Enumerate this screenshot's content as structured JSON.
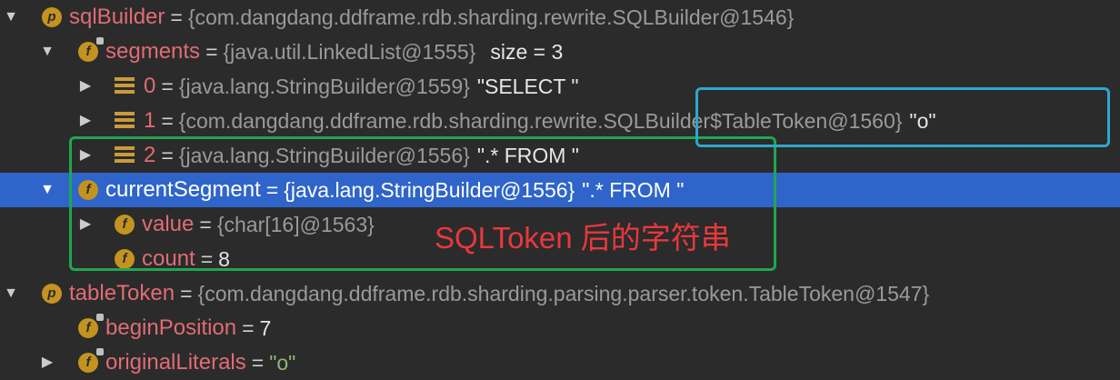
{
  "variables": [
    {
      "arrow": "▼",
      "icon": "p",
      "name": "sqlBuilder",
      "ref": "{com.dangdang.ddframe.rdb.sharding.rewrite.SQLBuilder@1546}"
    },
    {
      "arrow": "▼",
      "icon": "f",
      "name": "segments",
      "ref": "{java.util.LinkedList@1555}",
      "size": "size = 3"
    },
    {
      "arrow": "▶",
      "index": "0",
      "ref": "{java.lang.StringBuilder@1559}",
      "value": "\"SELECT \""
    },
    {
      "arrow": "▶",
      "index": "1",
      "ref": "{com.dangdang.ddframe.rdb.sharding.rewrite.SQLBuilder$TableToken@1560}",
      "value": "\"o\""
    },
    {
      "arrow": "▶",
      "index": "2",
      "ref": "{java.lang.StringBuilder@1556}",
      "value": "\".* FROM \""
    },
    {
      "arrow": "▼",
      "icon": "f",
      "name": "currentSegment",
      "ref": "{java.lang.StringBuilder@1556}",
      "value": "\".* FROM \""
    },
    {
      "arrow": "▶",
      "icon": "f",
      "name": "value",
      "ref": "{char[16]@1563}"
    },
    {
      "icon": "f",
      "name": "count",
      "value": "8"
    },
    {
      "arrow": "▼",
      "icon": "p",
      "name": "tableToken",
      "ref": "{com.dangdang.ddframe.rdb.sharding.parsing.parser.token.TableToken@1547}"
    },
    {
      "icon": "f",
      "name": "beginPosition",
      "value": "7"
    },
    {
      "arrow": "▶",
      "icon": "f",
      "name": "originalLiterals",
      "value": "\"o\""
    }
  ],
  "eq": "=",
  "annotation": "SQLToken 后的字符串",
  "colors": {
    "background": "#2b2b2b",
    "selection": "#2f65ca",
    "field_name": "#e06c75",
    "green_highlight": "#1fa750",
    "blue_highlight": "#2fa6cc",
    "annotation": "#e8383d"
  }
}
